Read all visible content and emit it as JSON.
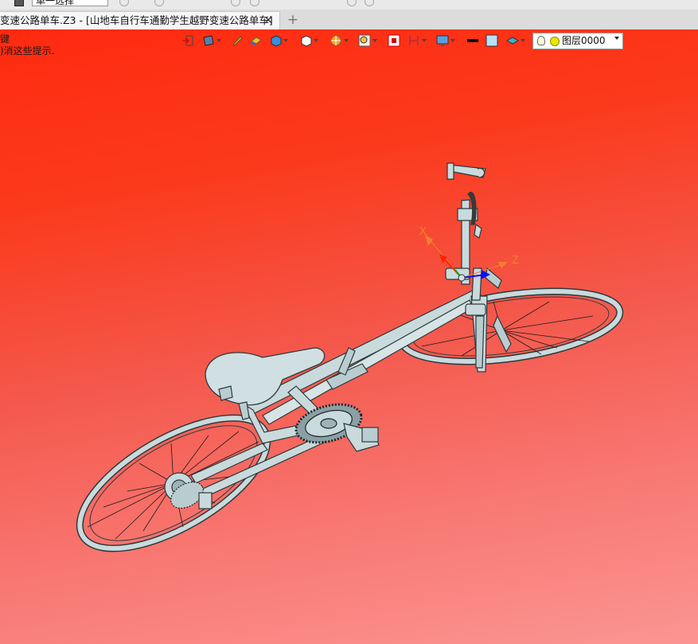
{
  "toolbar_top": {
    "selection_filter": "单一选择"
  },
  "tabs": [
    {
      "label": "变速公路单车.Z3 - [山地车自行车通勤学生越野变速公路单车]",
      "active": true,
      "close": "✕"
    }
  ],
  "new_tab": "+",
  "viewport": {
    "hint_line1": "键",
    "hint_line2": ")消这些提示."
  },
  "view_toolbar": {
    "layer": "图层0000",
    "icons": [
      "exit-icon",
      "view-orient-icon",
      "pen-icon",
      "shade-mode-icon",
      "cube-display-icon",
      "wireframe-cube-icon",
      "render-icon",
      "zoom-icon",
      "section-icon",
      "clip-plane-icon",
      "monitor-icon",
      "line-color-icon",
      "fill-color-icon",
      "layer-manager-icon",
      "bulb-icon"
    ]
  },
  "model": {
    "axis_labels": {
      "x": "X",
      "z": "Z"
    },
    "colors": {
      "frame": "#c9dadd",
      "edge": "#2d3a3c",
      "axis_x": "#ff2200",
      "axis_y": "#10b010",
      "axis_z": "#1010ee",
      "axis_label": "#f08030"
    }
  }
}
